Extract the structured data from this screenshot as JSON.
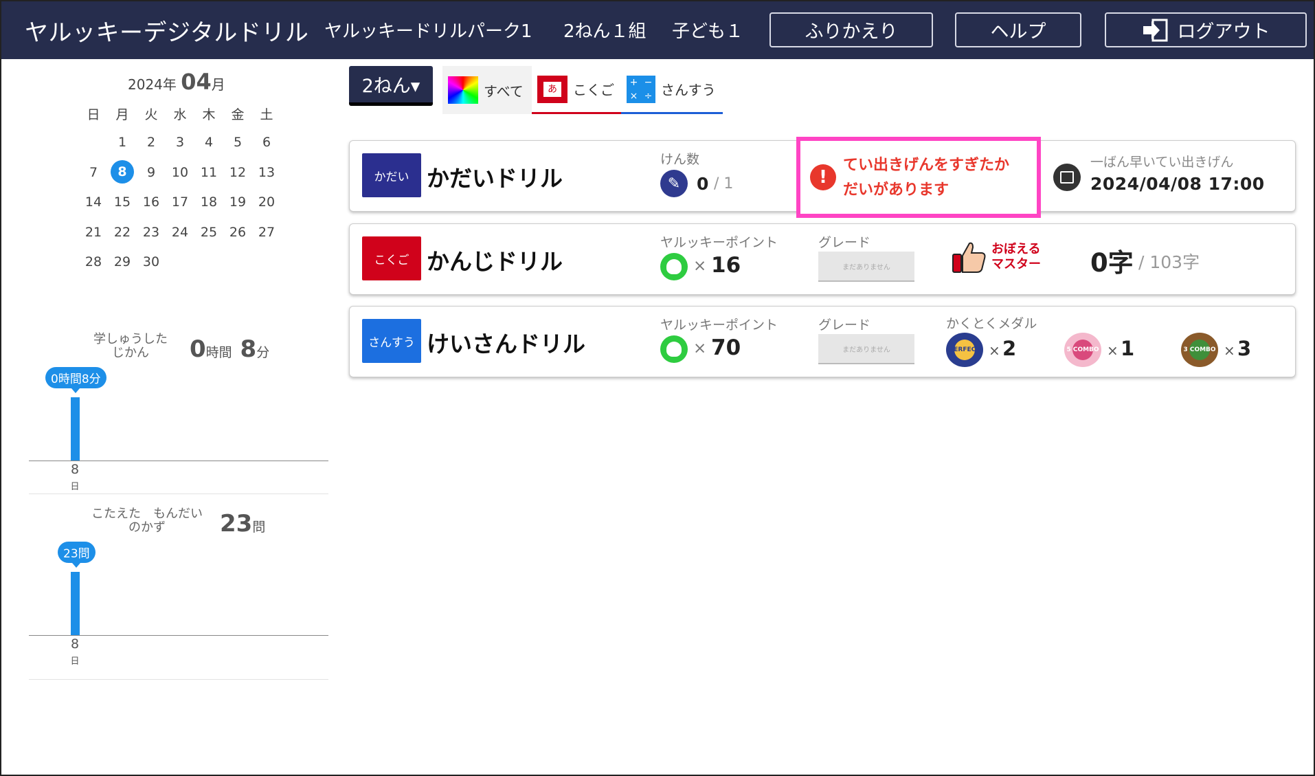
{
  "header": {
    "app_title": "ヤルッキーデジタルドリル",
    "school": "ヤルッキードリルパーク1",
    "class": "2ねん１組",
    "child": "子ども１",
    "review_button": "ふりかえり",
    "help_button": "ヘルプ",
    "logout_button": "ログアウト",
    "logout_icon": "logout-icon"
  },
  "calendar": {
    "year_label": "2024年",
    "month": "04",
    "month_unit": "月",
    "weekdays": [
      "日",
      "月",
      "火",
      "水",
      "木",
      "金",
      "土"
    ],
    "weeks": [
      [
        "",
        "1",
        "2",
        "3",
        "4",
        "5",
        "6"
      ],
      [
        "7",
        "8",
        "9",
        "10",
        "11",
        "12",
        "13"
      ],
      [
        "14",
        "15",
        "16",
        "17",
        "18",
        "19",
        "20"
      ],
      [
        "21",
        "22",
        "23",
        "24",
        "25",
        "26",
        "27"
      ],
      [
        "28",
        "29",
        "30",
        "",
        "",
        "",
        ""
      ]
    ],
    "today": "8",
    "today_color": "#1d8fe8"
  },
  "study_time": {
    "label_line1": "学しゅうした",
    "label_line2": "じかん",
    "hours": "0",
    "hours_unit": "時間",
    "minutes": "8",
    "minutes_unit": "分",
    "bubble": "0時間8分",
    "axis_day": "8",
    "axis_unit": "日",
    "bar_minutes": 8
  },
  "answered": {
    "label_line1": "こたえた　もんだい",
    "label_line2": "のかず",
    "count": "23",
    "unit": "問",
    "bubble": "23問",
    "axis_day": "8",
    "axis_unit": "日"
  },
  "tabs": {
    "grade_select": "2ねん▾",
    "all": "すべて",
    "kokugo": "こくご",
    "kokugo_icon_char": "あ",
    "sansu": "さんすう",
    "sansu_icon_chars": [
      "+",
      "−",
      "×",
      "÷"
    ]
  },
  "drills": {
    "kadai": {
      "badge": "かだい",
      "badge_color": "#2b2f8f",
      "title": "かだいドリル",
      "count_label": "けん数",
      "count": "0",
      "count_total": "/ 1",
      "alert_line1": "てい出きげんをすぎたか",
      "alert_line2": "だいがあります",
      "alert_icon": "!",
      "deadline_label": "一ばん早いてい出きげん",
      "deadline_value": "2024/04/08 17:00"
    },
    "kanji": {
      "badge": "こくご",
      "badge_color": "#d0021b",
      "title": "かんじドリル",
      "points_label": "ヤルッキーポイント",
      "times": "×",
      "points": "16",
      "grade_label": "グレード",
      "grade_box": "まだありません",
      "memorize_line1": "おぼえる",
      "memorize_line2": "マスター",
      "kanji_count": "0字",
      "kanji_total": "/ 103字"
    },
    "keisan": {
      "badge": "さんすう",
      "badge_color": "#1c6fe0",
      "title": "けいさんドリル",
      "points_label": "ヤルッキーポイント",
      "times": "×",
      "points": "70",
      "grade_label": "グレード",
      "grade_box": "まだありません",
      "medal_label": "かくとくメダル",
      "medals": [
        {
          "name": "PERFECT",
          "x": "×",
          "count": "2"
        },
        {
          "name": "5 COMBO",
          "x": "×",
          "count": "1"
        },
        {
          "name": "3 COMBO",
          "x": "×",
          "count": "3"
        }
      ]
    }
  }
}
